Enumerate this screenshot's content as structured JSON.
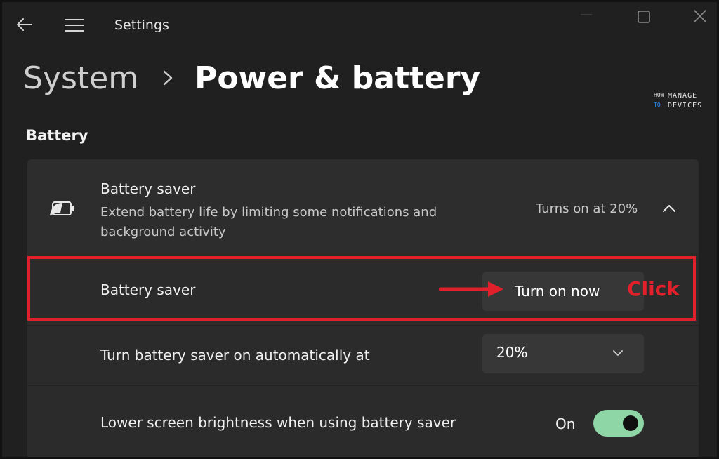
{
  "window": {
    "app_title": "Settings",
    "controls": [
      "minimize-icon",
      "maximize-icon",
      "close-icon"
    ]
  },
  "breadcrumb": {
    "parent": "System",
    "separator_icon": "chevron-right-icon",
    "current": "Power & battery"
  },
  "watermark": {
    "line1_small": "HOW",
    "line2_small": "TO",
    "line1": "MANAGE",
    "line2": "DEVICES"
  },
  "section": {
    "title": "Battery"
  },
  "battery_saver_card": {
    "icon": "battery-saver-icon",
    "title": "Battery saver",
    "description": "Extend battery life by limiting some notifications and background activity",
    "status": "Turns on at 20%",
    "expanded": true,
    "rows": {
      "turn_on": {
        "label": "Battery saver",
        "button_label": "Turn on now"
      },
      "auto_threshold": {
        "label": "Turn battery saver on automatically at",
        "selected_value": "20%"
      },
      "lower_brightness": {
        "label": "Lower screen brightness when using battery saver",
        "toggle_label": "On",
        "toggle_on": true
      }
    }
  },
  "annotation": {
    "callout_text": "Click",
    "color": "#e0202a"
  },
  "colors": {
    "background": "#202020",
    "card": "#2b2b2b",
    "button": "#373737",
    "toggle_accent": "#8fd6a6"
  }
}
